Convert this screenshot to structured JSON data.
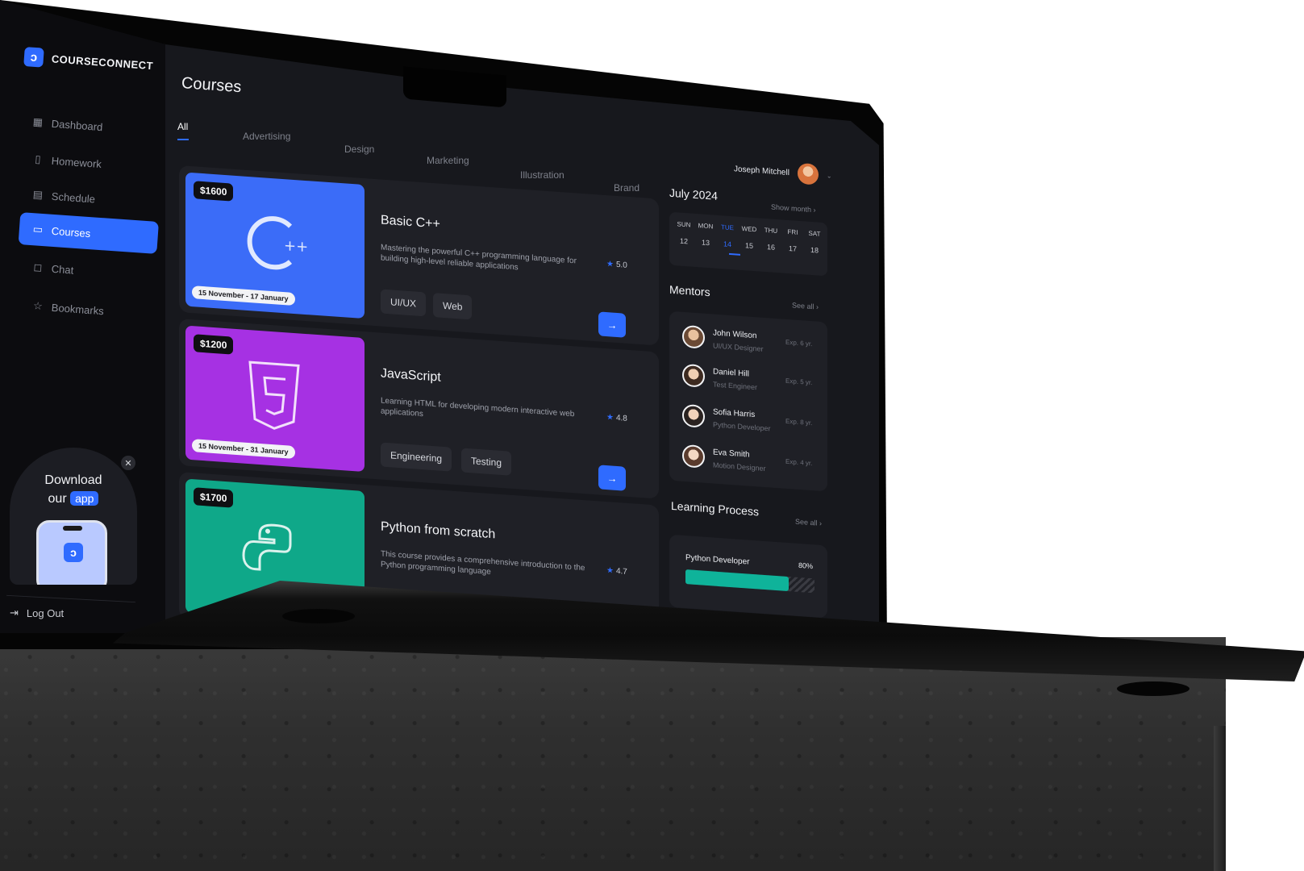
{
  "app": {
    "name": "COURSECONNECT"
  },
  "sidebar": {
    "items": [
      {
        "label": "Dashboard",
        "icon": "dashboard-icon"
      },
      {
        "label": "Homework",
        "icon": "document-icon"
      },
      {
        "label": "Schedule",
        "icon": "calendar-icon"
      },
      {
        "label": "Courses",
        "icon": "folder-icon",
        "active": true
      },
      {
        "label": "Chat",
        "icon": "chat-icon"
      },
      {
        "label": "Bookmarks",
        "icon": "star-icon"
      }
    ],
    "download": {
      "line1": "Download",
      "line2": "our",
      "highlight": "app"
    },
    "logout": "Log Out"
  },
  "main": {
    "title": "Courses",
    "tabs": [
      "All",
      "Advertising",
      "Design",
      "Marketing",
      "Illustration",
      "Brand"
    ],
    "courses": [
      {
        "title": "Basic C++",
        "price": "$1600",
        "dates": "15 November - 17 January",
        "desc": "Mastering the powerful C++ programming language for building high-level reliable applications",
        "rating": "5.0",
        "tags": [
          "UI/UX",
          "Web"
        ],
        "color": "#3b6cf8",
        "art": "cpp-logo-icon"
      },
      {
        "title": "JavaScript",
        "price": "$1200",
        "dates": "15 November - 31 January",
        "desc": "Learning HTML for developing modern interactive web applications",
        "rating": "4.8",
        "tags": [
          "Engineering",
          "Testing"
        ],
        "color": "#a631e3",
        "art": "html5-logo-icon"
      },
      {
        "title": "Python from scratch",
        "price": "$1700",
        "dates": "",
        "desc": "This course provides a comprehensive introduction to the Python programming language",
        "rating": "4.7",
        "tags": [],
        "color": "#0fa889",
        "art": "python-logo-icon"
      }
    ]
  },
  "right": {
    "user": "Joseph Mitchell",
    "calendar": {
      "month": "July 2024",
      "link": "Show month",
      "days": [
        "SUN",
        "MON",
        "TUE",
        "WED",
        "THU",
        "FRI",
        "SAT"
      ],
      "dates": [
        "12",
        "13",
        "14",
        "15",
        "16",
        "17",
        "18"
      ],
      "active_index": 2
    },
    "mentors": {
      "title": "Mentors",
      "link": "See all",
      "list": [
        {
          "name": "John Wilson",
          "role": "UI/UX Designer",
          "exp": "Exp. 6 yr."
        },
        {
          "name": "Daniel Hill",
          "role": "Test Engineer",
          "exp": "Exp. 5 yr."
        },
        {
          "name": "Sofia Harris",
          "role": "Python Developer",
          "exp": "Exp. 8 yr."
        },
        {
          "name": "Eva Smith",
          "role": "Motion Designer",
          "exp": "Exp. 4 yr."
        }
      ]
    },
    "learning": {
      "title": "Learning Process",
      "link": "See all",
      "item": "Python Developer",
      "percent_label": "80%",
      "percent": 80
    }
  }
}
